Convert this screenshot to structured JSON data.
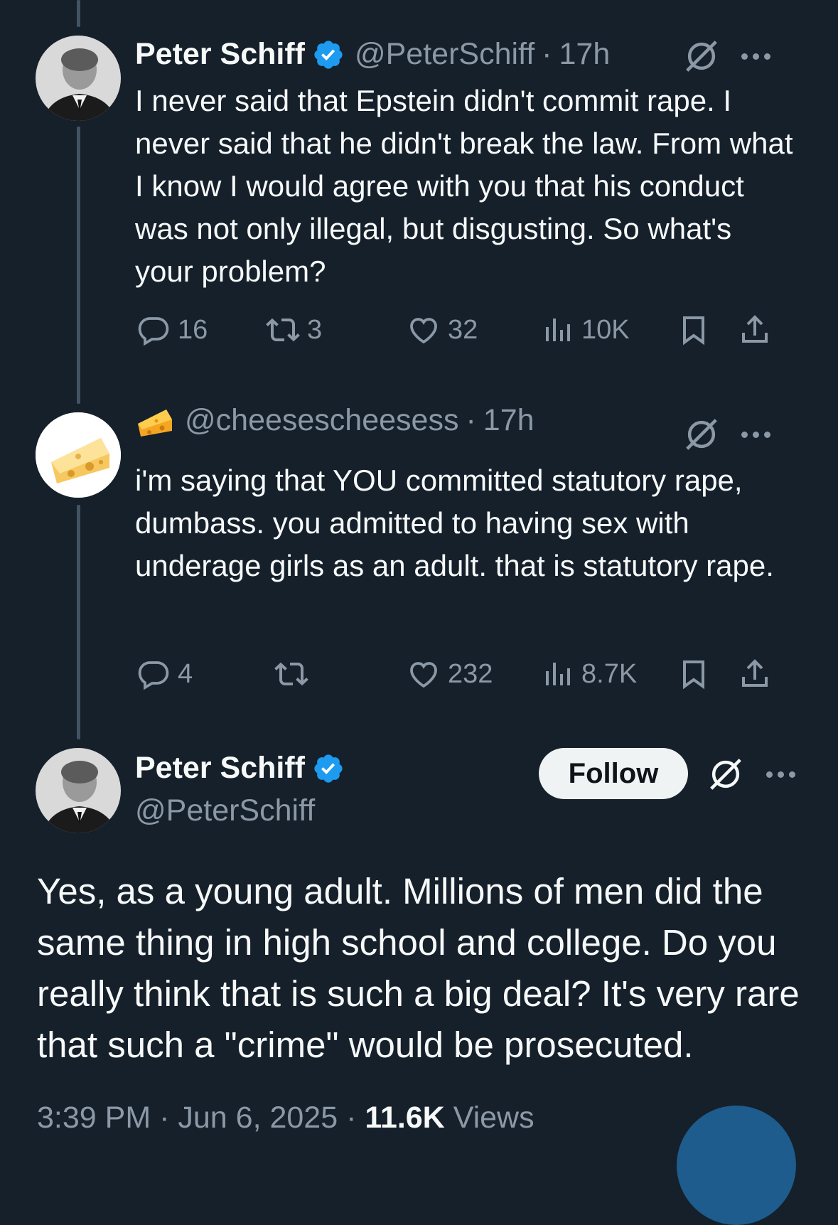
{
  "tweets": [
    {
      "name": "Peter Schiff",
      "handle": "@PeterSchiff",
      "sep": "·",
      "time": "17h",
      "text": "I never said that Epstein didn't commit rape. I never said that he didn't break the law. From what I know I would agree with you that his conduct was not only illegal, but disgusting. So what's your problem?",
      "replies": "16",
      "reposts": "3",
      "likes": "32",
      "views": "10K"
    },
    {
      "name_emoji": "🧀",
      "handle": "@cheesescheesess",
      "sep": "·",
      "time": "17h",
      "text": "i'm saying that YOU committed statutory rape, dumbass. you admitted to having sex with underage girls as an adult. that is statutory rape.",
      "replies": "4",
      "reposts": "",
      "likes": "232",
      "views": "8.7K"
    }
  ],
  "main": {
    "name": "Peter Schiff",
    "handle": "@PeterSchiff",
    "follow_label": "Follow",
    "text": "Yes, as a young adult. Millions of men did the same thing in high school and college. Do you really think that is such a big deal? It's very rare that such a \"crime\" would be prosecuted.",
    "time": "3:39 PM",
    "sep1": "·",
    "date": "Jun 6, 2025",
    "sep2": "·",
    "views_count": "11.6K",
    "views_label": "Views"
  },
  "colors": {
    "background": "#15202b",
    "text": "#f7f9f9",
    "secondary": "#8b98a5",
    "verified": "#1d9bf0",
    "thread_line": "#425364"
  },
  "icons": [
    "reply-icon",
    "repost-icon",
    "like-icon",
    "views-icon",
    "bookmark-icon",
    "share-icon",
    "grok-icon",
    "more-icon",
    "verified-badge-icon",
    "cheese-emoji"
  ]
}
